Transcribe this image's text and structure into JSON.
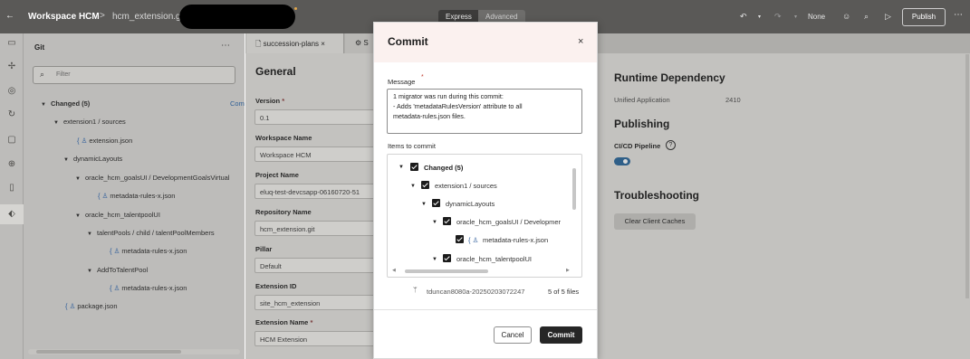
{
  "topbar": {
    "back_icon": "←",
    "workspace_title": "Workspace HCM",
    "separator": ">",
    "repo": "hcm_extension.g",
    "mode_express": "Express",
    "mode_advanced": "Advanced",
    "undo_icon": "↶",
    "redo_icon": "↷",
    "none_label": "None",
    "publish_label": "Publish",
    "more_icon": "⋯"
  },
  "rail": {
    "icons": [
      "comment-icon",
      "pointer-icon",
      "settings-icon",
      "translate-icon",
      "component-icon",
      "globe-icon",
      "page-icon",
      "git-icon"
    ]
  },
  "git": {
    "title": "Git",
    "more": "⋯",
    "filter_placeholder": "Filter",
    "commit_link_cut": "Com",
    "tree": {
      "changed": "Changed (5)",
      "extension_sources": "extension1 / sources",
      "extension_json": "extension.json",
      "dynamic_layouts": "dynamicLayouts",
      "goals_ui": "oracle_hcm_goalsUI / DevelopmentGoalsVirtual",
      "metadata_rules_1": "metadata-rules-x.json",
      "talentpool_ui": "oracle_hcm_talentpoolUI",
      "talentpools_child": "talentPools / child / talentPoolMembers",
      "metadata_rules_2": "metadata-rules-x.json",
      "add_to_talent_pool": "AddToTalentPool",
      "metadata_rules_3": "metadata-rules-x.json",
      "package_json": "package.json"
    }
  },
  "editor": {
    "tab1": "succession-plans",
    "tab1_close": "×",
    "tab2": "S",
    "general_title": "General",
    "fields": {
      "version_label": "Version",
      "version_value": "0.1",
      "workspace_name_label": "Workspace Name",
      "workspace_name_value": "Workspace HCM",
      "project_name_label": "Project Name",
      "project_name_value": "eluq-test-devcsapp-06160720-51",
      "repository_name_label": "Repository Name",
      "repository_name_value": "hcm_extension.git",
      "pillar_label": "Pillar",
      "pillar_value": "Default",
      "extension_id_label": "Extension ID",
      "extension_id_value": "site_hcm_extension",
      "extension_name_label": "Extension Name",
      "extension_name_value": "HCM Extension"
    },
    "runtime_dependency_title": "Runtime Dependency",
    "unified_application_label": "Unified Application",
    "unified_application_value": "2410",
    "publishing_title": "Publishing",
    "cicd_label": "CI/CD Pipeline",
    "cicd_enabled": true,
    "troubleshooting_title": "Troubleshooting",
    "clear_caches_label": "Clear Client Caches"
  },
  "modal": {
    "title": "Commit",
    "close": "×",
    "message_label": "Message",
    "required_mark": "*",
    "message_line1": "1 migrator was run during this commit:",
    "message_line2": "- Adds 'metadataRulesVersion' attribute to all",
    "message_line3": "metadata-rules.json files.",
    "items_label": "Items to commit",
    "items": {
      "changed": "Changed (5)",
      "extension_sources": "extension1 / sources",
      "dynamic_layouts": "dynamicLayouts",
      "goals_ui": "oracle_hcm_goalsUI / Developmer",
      "metadata_rules": "metadata-rules-x.json",
      "talentpool_ui": "oracle_hcm_talentpoolUI"
    },
    "branch": "tduncan8080a-20250203072247",
    "files_count": "5 of 5 files",
    "cancel_label": "Cancel",
    "commit_label": "Commit"
  }
}
